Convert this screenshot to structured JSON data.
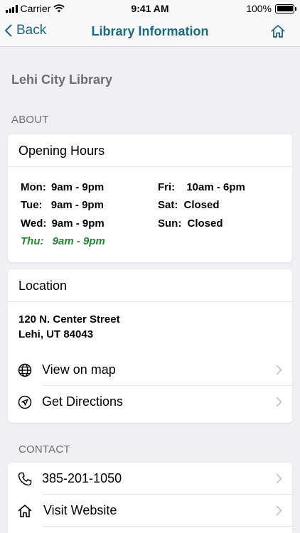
{
  "status_bar": {
    "carrier": "Carrier",
    "time": "9:41 AM",
    "battery": "100%"
  },
  "nav": {
    "back_label": "Back",
    "title": "Library Information"
  },
  "library_name": "Lehi City Library",
  "about_header": "ABOUT",
  "hours_card": {
    "title": "Opening Hours",
    "rows": [
      {
        "day": "Mon:",
        "hours": "9am - 9pm"
      },
      {
        "day": "Tue:",
        "hours": "9am - 9pm"
      },
      {
        "day": "Wed:",
        "hours": "9am - 9pm"
      },
      {
        "day": "Thu:",
        "hours": "9am - 9pm"
      },
      {
        "day": "Fri:",
        "hours": "10am - 6pm"
      },
      {
        "day": "Sat:",
        "hours": "Closed"
      },
      {
        "day": "Sun:",
        "hours": "Closed"
      }
    ],
    "today_color": "#1f8a2e"
  },
  "location_card": {
    "title": "Location",
    "address_line1": "120 N. Center Street",
    "address_line2": "Lehi, UT 84043",
    "view_map_label": "View on map",
    "directions_label": "Get Directions"
  },
  "contact_header": "CONTACT",
  "contact_card": {
    "phone": "385-201-1050",
    "website_label": "Visit Website"
  },
  "colors": {
    "accent": "#1a6a84",
    "background": "#efeff4",
    "secondary_text": "#6d6d72"
  }
}
